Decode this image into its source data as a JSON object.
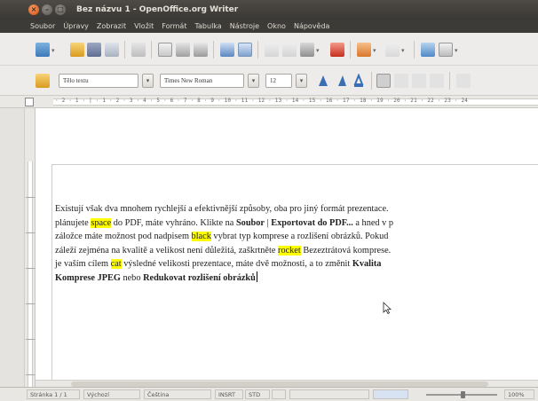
{
  "window": {
    "title": "Bez názvu 1 - OpenOffice.org Writer",
    "controls": [
      "×",
      "–",
      "□"
    ]
  },
  "menubar": [
    "Soubor",
    "Úpravy",
    "Zobrazit",
    "Vložit",
    "Formát",
    "Tabulka",
    "Nástroje",
    "Okno",
    "Nápověda"
  ],
  "formatting": {
    "style": "Tělo textu",
    "font": "Times New Roman",
    "size": "12"
  },
  "ruler": {
    "marks": "· 2 · 1 · | · 1 · 2 · 3 · 4 · 5 · 6 · 7 · 8 · 9 · 10 · 11 · 12 · 13 · 14 · 15 · 16 · 17 · 18 · 19 · 20 · 21 · 22 · 23 · 24"
  },
  "document": {
    "line1": "Existují však dva mnohem rychlejší a efektivnější způsoby, oba pro jiný formát prezentace.",
    "line2_a": "plánujete ",
    "line2_hl": "space",
    "line2_b": " do PDF, máte vyhráno. Klikte na ",
    "line2_bold1": "Soubor",
    "line2_c": " | ",
    "line2_bold2": "Exportovat do PDF...",
    "line2_d": " a hned v p",
    "line3_a": "záložce máte možnost pod nadpisem ",
    "line3_hl": "black",
    "line3_b": " vybrat typ komprese a rozlišení obrázků. Pokud",
    "line4_a": "záleží zejména na kvalitě a velikost není důležitá, zaškrtněte ",
    "line4_hl": "rocket",
    "line4_b": " Bezeztrátová komprese.",
    "line5_a": "je vaším cílem ",
    "line5_hl": "cat",
    "line5_b": " výsledné velikosti prezentace, máte dvě možnosti, a to změnit ",
    "line5_bold": "Kvalita",
    "line6_bold1": "Komprese JPEG",
    "line6_a": " nebo ",
    "line6_bold2": "Redukovat rozlišení obrázků"
  },
  "statusbar": {
    "page": "Stránka 1 / 1",
    "style": "Výchozí",
    "language": "Čeština",
    "mode": "INSRT",
    "sel": "STD",
    "zoom": "100%"
  }
}
